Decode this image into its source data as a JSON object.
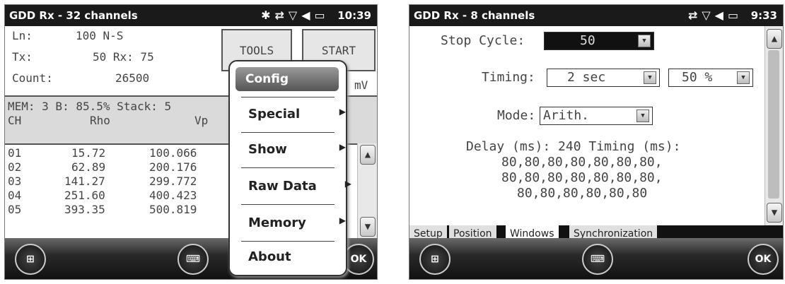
{
  "screen1": {
    "status": {
      "title": "GDD Rx - 32 channels",
      "time": "10:39"
    },
    "info": [
      {
        "label": "Ln:",
        "value": "100 N-S"
      },
      {
        "label": "Tx:",
        "value": "50 Rx: 75"
      },
      {
        "label": "Count:",
        "value": "26500"
      }
    ],
    "tools_label": "TOOLS",
    "start_label": "START",
    "unit": "mV",
    "mem_line": "MEM: 3 B: 85.5% Stack: 5",
    "columns": {
      "ch": "CH",
      "rho": "Rho",
      "vp": "Vp"
    },
    "rows": [
      {
        "ch": "01",
        "rho": "15.72",
        "vp": "100.066"
      },
      {
        "ch": "02",
        "rho": "62.89",
        "vp": "200.176"
      },
      {
        "ch": "03",
        "rho": "141.27",
        "vp": "299.772"
      },
      {
        "ch": "04",
        "rho": "251.60",
        "vp": "400.423"
      },
      {
        "ch": "05",
        "rho": "393.35",
        "vp": "500.819"
      }
    ],
    "menu": [
      "Config",
      "Special",
      "Show",
      "Raw Data",
      "Memory",
      "About"
    ],
    "ok_label": "OK"
  },
  "screen2": {
    "status": {
      "title": "GDD Rx - 8 channels",
      "time": "9:33"
    },
    "stop_cycle": {
      "label": "Stop Cycle:",
      "value": "50"
    },
    "timing": {
      "label": "Timing:",
      "value": "2 sec",
      "percent": "50 %"
    },
    "mode": {
      "label": "Mode:",
      "value": "Arith."
    },
    "delay_text": "Delay (ms): 240 Timing (ms):",
    "timing_lines": [
      "80,80,80,80,80,80,80,",
      "80,80,80,80,80,80,80,",
      "80,80,80,80,80,80"
    ],
    "tabs": [
      "Setup",
      "Position",
      "Windows",
      "Synchronization"
    ],
    "active_tab": "Windows",
    "ok_label": "OK"
  }
}
